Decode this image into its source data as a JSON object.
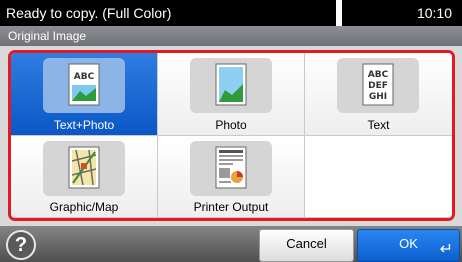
{
  "status": {
    "message": "Ready to copy. (Full Color)",
    "time": "10:10"
  },
  "screen": {
    "title": "Original Image"
  },
  "options": [
    {
      "label": "Text+Photo",
      "icon": "text-photo-icon",
      "selected": true
    },
    {
      "label": "Photo",
      "icon": "photo-icon",
      "selected": false
    },
    {
      "label": "Text",
      "icon": "text-icon",
      "selected": false
    },
    {
      "label": "Graphic/Map",
      "icon": "graphic-map-icon",
      "selected": false
    },
    {
      "label": "Printer Output",
      "icon": "printer-output-icon",
      "selected": false
    }
  ],
  "icon_text": {
    "text_photo_icon": "ABC",
    "text_icon_lines": [
      "ABC",
      "DEF",
      "GHI"
    ]
  },
  "buttons": {
    "help": "?",
    "cancel": "Cancel",
    "ok": "OK",
    "enter": "↵"
  },
  "colors": {
    "accent": "#0b57c6",
    "frame": "#e21a22"
  }
}
